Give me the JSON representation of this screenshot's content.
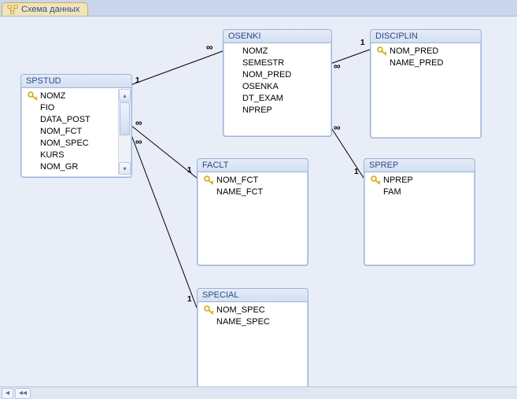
{
  "tab": {
    "label": "Схема данных"
  },
  "tables": {
    "spstud": {
      "title": "SPSTUD",
      "fields": [
        {
          "key": true,
          "name": "NOMZ"
        },
        {
          "key": false,
          "name": "FIO"
        },
        {
          "key": false,
          "name": "DATA_POST"
        },
        {
          "key": false,
          "name": "NOM_FCT"
        },
        {
          "key": false,
          "name": "NOM_SPEC"
        },
        {
          "key": false,
          "name": "KURS"
        },
        {
          "key": false,
          "name": "NOM_GR"
        }
      ]
    },
    "osenki": {
      "title": "OSENKI",
      "fields": [
        {
          "key": false,
          "name": "NOMZ"
        },
        {
          "key": false,
          "name": "SEMESTR"
        },
        {
          "key": false,
          "name": "NOM_PRED"
        },
        {
          "key": false,
          "name": "OSENKA"
        },
        {
          "key": false,
          "name": "DT_EXAM"
        },
        {
          "key": false,
          "name": "NPREP"
        }
      ]
    },
    "disciplin": {
      "title": "DISCIPLIN",
      "fields": [
        {
          "key": true,
          "name": "NOM_PRED"
        },
        {
          "key": false,
          "name": "NAME_PRED"
        }
      ]
    },
    "faclt": {
      "title": "FACLT",
      "fields": [
        {
          "key": true,
          "name": "NOM_FCT"
        },
        {
          "key": false,
          "name": "NAME_FCT"
        }
      ]
    },
    "sprep": {
      "title": "SPREP",
      "fields": [
        {
          "key": true,
          "name": "NPREP"
        },
        {
          "key": false,
          "name": "FAM"
        }
      ]
    },
    "special": {
      "title": "SPECIAL",
      "fields": [
        {
          "key": true,
          "name": "NOM_SPEC"
        },
        {
          "key": false,
          "name": "NAME_SPEC"
        }
      ]
    }
  },
  "relationships": [
    {
      "from": "spstud",
      "from_card": "1",
      "to": "osenki",
      "to_card": "∞"
    },
    {
      "from": "spstud",
      "from_card": "∞",
      "to": "faclt",
      "to_card": "1"
    },
    {
      "from": "spstud",
      "from_card": "∞",
      "to": "special",
      "to_card": "1"
    },
    {
      "from": "disciplin",
      "from_card": "1",
      "to": "osenki",
      "to_card": "∞"
    },
    {
      "from": "sprep",
      "from_card": "1",
      "to": "osenki",
      "to_card": "∞"
    }
  ],
  "key_icon_alt": "primary-key"
}
